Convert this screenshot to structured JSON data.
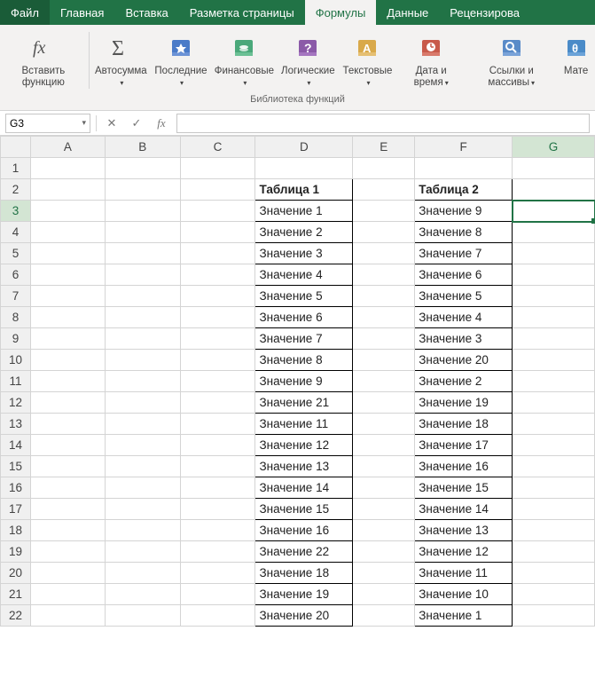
{
  "tabs": {
    "file": "Файл",
    "home": "Главная",
    "insert": "Вставка",
    "pagelayout": "Разметка страницы",
    "formulas": "Формулы",
    "data": "Данные",
    "review": "Рецензирова"
  },
  "ribbon": {
    "insert_function": "Вставить функцию",
    "autosum": "Автосумма",
    "recent": "Последние",
    "financial": "Финансовые",
    "logical": "Логические",
    "text": "Текстовые",
    "datetime": "Дата и время",
    "lookup": "Ссылки и массивы",
    "math": "Мате",
    "group_label": "Библиотека функций"
  },
  "namebox": "G3",
  "fx_label": "fx",
  "columns": [
    "A",
    "B",
    "C",
    "D",
    "E",
    "F",
    "G"
  ],
  "rows_count": 22,
  "table1": {
    "header": "Таблица 1",
    "values": [
      "Значение 1",
      "Значение 2",
      "Значение 3",
      "Значение 4",
      "Значение 5",
      "Значение 6",
      "Значение 7",
      "Значение 8",
      "Значение 9",
      "Значение 21",
      "Значение 11",
      "Значение 12",
      "Значение 13",
      "Значение 14",
      "Значение 15",
      "Значение 16",
      "Значение 22",
      "Значение 18",
      "Значение 19",
      "Значение 20"
    ]
  },
  "table2": {
    "header": "Таблица 2",
    "values": [
      "Значение 9",
      "Значение 8",
      "Значение 7",
      "Значение 6",
      "Значение 5",
      "Значение 4",
      "Значение 3",
      "Значение 20",
      "Значение 2",
      "Значение 19",
      "Значение 18",
      "Значение 17",
      "Значение 16",
      "Значение 15",
      "Значение 14",
      "Значение 13",
      "Значение 12",
      "Значение 11",
      "Значение 10",
      "Значение 1"
    ]
  },
  "selection": {
    "col": "G",
    "row": 3
  }
}
